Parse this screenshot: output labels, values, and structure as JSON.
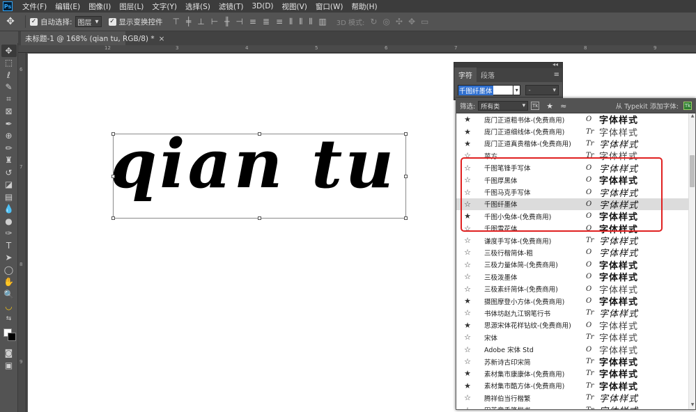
{
  "app": {
    "logo": "Ps"
  },
  "menubar": {
    "items": [
      "文件(F)",
      "编辑(E)",
      "图像(I)",
      "图层(L)",
      "文字(Y)",
      "选择(S)",
      "滤镜(T)",
      "3D(D)",
      "视图(V)",
      "窗口(W)",
      "帮助(H)"
    ]
  },
  "options": {
    "auto_select_label": "自动选择:",
    "auto_select_value": "图层",
    "show_transform_label": "显示变换控件",
    "mode_3d_label": "3D 模式:"
  },
  "document": {
    "tab_title": "未标题-1 @ 168% (qian tu, RGB/8) *",
    "close_glyph": "×",
    "canvas_text": "qian tu"
  },
  "rulers": {
    "top_labels": [
      "12",
      "3",
      "4",
      "5",
      "6",
      "7",
      "8",
      "9"
    ],
    "left_labels": [
      "6",
      "7",
      "8",
      "9"
    ]
  },
  "character_panel": {
    "tabs": [
      "字符",
      "段落"
    ],
    "font_family_value": "千图纤墨体",
    "font_style_value": "-"
  },
  "font_popup": {
    "filter_label": "筛选:",
    "filter_value": "所有类",
    "typekit_label": "从 Typekit 添加字体:",
    "tk_label": "Tk",
    "fonts": [
      {
        "name": "庞门正道粗书体-(免费商用)",
        "fav": true,
        "type": "O",
        "sample": "字体样式",
        "style": "bold"
      },
      {
        "name": "庞门正道细线体-(免费商用)",
        "fav": true,
        "type": "Tr",
        "sample": "字体样式",
        "style": "light"
      },
      {
        "name": "庞门正道真贵楷体-(免费商用)",
        "fav": true,
        "type": "Tr",
        "sample": "字体样式",
        "style": "script"
      },
      {
        "name": "苹方",
        "fav": false,
        "type": "Tr",
        "sample": "字体样式",
        "style": "light"
      },
      {
        "name": "千图笔锋手写体",
        "fav": false,
        "type": "O",
        "sample": "字体样式",
        "style": "script"
      },
      {
        "name": "千图厚黑体",
        "fav": false,
        "type": "O",
        "sample": "字体样式",
        "style": "bold"
      },
      {
        "name": "千图马克手写体",
        "fav": false,
        "type": "O",
        "sample": "字体样式",
        "style": "script"
      },
      {
        "name": "千图纤墨体",
        "fav": false,
        "type": "O",
        "sample": "字体样式",
        "style": "script"
      },
      {
        "name": "千图小兔体-(免费商用)",
        "fav": true,
        "type": "O",
        "sample": "字体样式",
        "style": "bold"
      },
      {
        "name": "千图雪花体",
        "fav": false,
        "type": "O",
        "sample": "字体样式",
        "style": "bold"
      },
      {
        "name": "谦度手写体-(免费商用)",
        "fav": false,
        "type": "Tr",
        "sample": "字体样式",
        "style": "script"
      },
      {
        "name": "三极行楷简体-粗",
        "fav": false,
        "type": "O",
        "sample": "字体样式",
        "style": "script"
      },
      {
        "name": "三极力量体简-(免费商用)",
        "fav": false,
        "type": "O",
        "sample": "字体样式",
        "style": "bold"
      },
      {
        "name": "三极泼墨体",
        "fav": false,
        "type": "O",
        "sample": "字体样式",
        "style": "bold"
      },
      {
        "name": "三极素纤简体-(免费商用)",
        "fav": false,
        "type": "O",
        "sample": "字体样式",
        "style": "light"
      },
      {
        "name": "摄图摩登小方体-(免费商用)",
        "fav": true,
        "type": "O",
        "sample": "字体样式",
        "style": "bold"
      },
      {
        "name": "书体坊赵九江钢笔行书",
        "fav": false,
        "type": "Tr",
        "sample": "字体样式",
        "style": "script"
      },
      {
        "name": "思源宋体花样钻纹-(免费商用)",
        "fav": true,
        "type": "O",
        "sample": "字体样式",
        "style": "light"
      },
      {
        "name": "宋体",
        "fav": false,
        "type": "Tr",
        "sample": "字体样式",
        "style": "light"
      },
      {
        "name": "Adobe 宋体 Std",
        "fav": false,
        "type": "O",
        "sample": "字体样式",
        "style": "light"
      },
      {
        "name": "苏新诗古印宋简",
        "fav": false,
        "type": "Tr",
        "sample": "字体样式",
        "style": "bold"
      },
      {
        "name": "素材集市康康体-(免费商用)",
        "fav": true,
        "type": "Tr",
        "sample": "字体样式",
        "style": "bold"
      },
      {
        "name": "素材集市酷方体-(免费商用)",
        "fav": true,
        "type": "Tr",
        "sample": "字体样式",
        "style": "bold"
      },
      {
        "name": "腾祥伯当行楷繁",
        "fav": false,
        "type": "Tr",
        "sample": "字体样式",
        "style": "script"
      },
      {
        "name": "田英章手笔楷书",
        "fav": false,
        "type": "Tr",
        "sample": "字体样式",
        "style": "script"
      }
    ],
    "selected_font": "千图纤墨体"
  },
  "colors": {
    "annotation_box": "#e02020",
    "selection_highlight": "#3070d0",
    "panel_bg": "#535353"
  }
}
